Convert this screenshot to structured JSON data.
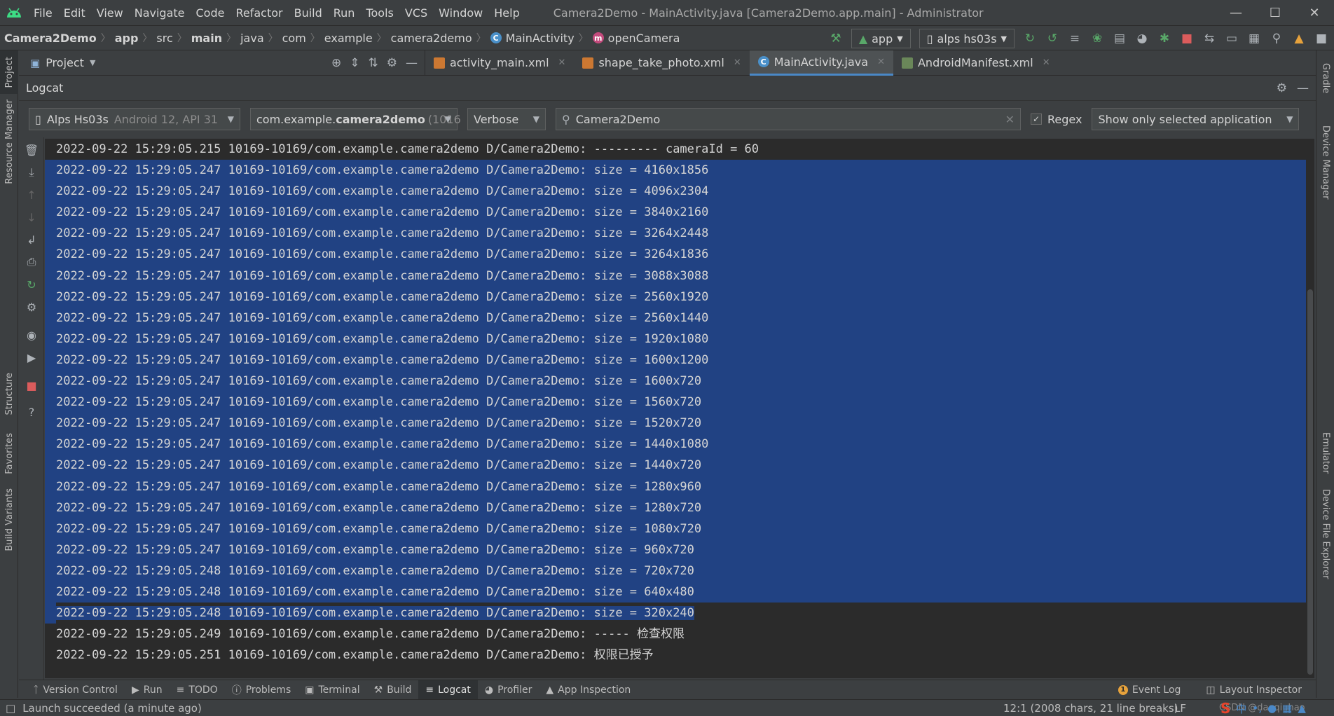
{
  "menubar": {
    "items": [
      "File",
      "Edit",
      "View",
      "Navigate",
      "Code",
      "Refactor",
      "Build",
      "Run",
      "Tools",
      "VCS",
      "Window",
      "Help"
    ],
    "title": "Camera2Demo - MainActivity.java [Camera2Demo.app.main] - Administrator"
  },
  "nav": {
    "crumbs": [
      "Camera2Demo",
      "app",
      "src",
      "main",
      "java",
      "com",
      "example",
      "camera2demo"
    ],
    "class_name": "MainActivity",
    "method_name": "openCamera",
    "run_config": "app",
    "device": "alps hs03s"
  },
  "project_panel": {
    "label": "Project"
  },
  "editor_tabs": [
    {
      "label": "activity_main.xml",
      "icon": "xml-file-icon"
    },
    {
      "label": "shape_take_photo.xml",
      "icon": "xml-file-icon"
    },
    {
      "label": "MainActivity.java",
      "icon": "java-class-icon",
      "active": true
    },
    {
      "label": "AndroidManifest.xml",
      "icon": "manifest-file-icon"
    }
  ],
  "logcat": {
    "title": "Logcat",
    "device_prefix": "Alps Hs03s",
    "device_suffix": "Android 12, API 31",
    "process_prefix": "com.example.",
    "process_bold": "camera2demo",
    "process_pid": "(1016",
    "level": "Verbose",
    "search": "Camera2Demo",
    "regex_label": "Regex",
    "regex_checked": true,
    "filter": "Show only selected application",
    "lines": [
      {
        "text": "2022-09-22 15:29:05.215 10169-10169/com.example.camera2demo D/Camera2Demo: --------- cameraId = 60",
        "selected": false
      },
      {
        "text": "2022-09-22 15:29:05.247 10169-10169/com.example.camera2demo D/Camera2Demo: size = 4160x1856",
        "selected": true
      },
      {
        "text": "2022-09-22 15:29:05.247 10169-10169/com.example.camera2demo D/Camera2Demo: size = 4096x2304",
        "selected": true
      },
      {
        "text": "2022-09-22 15:29:05.247 10169-10169/com.example.camera2demo D/Camera2Demo: size = 3840x2160",
        "selected": true
      },
      {
        "text": "2022-09-22 15:29:05.247 10169-10169/com.example.camera2demo D/Camera2Demo: size = 3264x2448",
        "selected": true
      },
      {
        "text": "2022-09-22 15:29:05.247 10169-10169/com.example.camera2demo D/Camera2Demo: size = 3264x1836",
        "selected": true
      },
      {
        "text": "2022-09-22 15:29:05.247 10169-10169/com.example.camera2demo D/Camera2Demo: size = 3088x3088",
        "selected": true
      },
      {
        "text": "2022-09-22 15:29:05.247 10169-10169/com.example.camera2demo D/Camera2Demo: size = 2560x1920",
        "selected": true
      },
      {
        "text": "2022-09-22 15:29:05.247 10169-10169/com.example.camera2demo D/Camera2Demo: size = 2560x1440",
        "selected": true
      },
      {
        "text": "2022-09-22 15:29:05.247 10169-10169/com.example.camera2demo D/Camera2Demo: size = 1920x1080",
        "selected": true
      },
      {
        "text": "2022-09-22 15:29:05.247 10169-10169/com.example.camera2demo D/Camera2Demo: size = 1600x1200",
        "selected": true
      },
      {
        "text": "2022-09-22 15:29:05.247 10169-10169/com.example.camera2demo D/Camera2Demo: size = 1600x720",
        "selected": true
      },
      {
        "text": "2022-09-22 15:29:05.247 10169-10169/com.example.camera2demo D/Camera2Demo: size = 1560x720",
        "selected": true
      },
      {
        "text": "2022-09-22 15:29:05.247 10169-10169/com.example.camera2demo D/Camera2Demo: size = 1520x720",
        "selected": true
      },
      {
        "text": "2022-09-22 15:29:05.247 10169-10169/com.example.camera2demo D/Camera2Demo: size = 1440x1080",
        "selected": true
      },
      {
        "text": "2022-09-22 15:29:05.247 10169-10169/com.example.camera2demo D/Camera2Demo: size = 1440x720",
        "selected": true
      },
      {
        "text": "2022-09-22 15:29:05.247 10169-10169/com.example.camera2demo D/Camera2Demo: size = 1280x960",
        "selected": true
      },
      {
        "text": "2022-09-22 15:29:05.247 10169-10169/com.example.camera2demo D/Camera2Demo: size = 1280x720",
        "selected": true
      },
      {
        "text": "2022-09-22 15:29:05.247 10169-10169/com.example.camera2demo D/Camera2Demo: size = 1080x720",
        "selected": true
      },
      {
        "text": "2022-09-22 15:29:05.247 10169-10169/com.example.camera2demo D/Camera2Demo: size = 960x720",
        "selected": true
      },
      {
        "text": "2022-09-22 15:29:05.248 10169-10169/com.example.camera2demo D/Camera2Demo: size = 720x720",
        "selected": true
      },
      {
        "text": "2022-09-22 15:29:05.248 10169-10169/com.example.camera2demo D/Camera2Demo: size = 640x480",
        "selected": true
      },
      {
        "text": "2022-09-22 15:29:05.248 10169-10169/com.example.camera2demo D/Camera2Demo: size = 320x240",
        "selected": true
      },
      {
        "text": "2022-09-22 15:29:05.249 10169-10169/com.example.camera2demo D/Camera2Demo: ----- 检查权限",
        "selected": false
      },
      {
        "text": "2022-09-22 15:29:05.251 10169-10169/com.example.camera2demo D/Camera2Demo: 权限已授予",
        "selected": false
      }
    ]
  },
  "left_strip": [
    "Project",
    "Resource Manager",
    "Structure",
    "Favorites",
    "Build Variants"
  ],
  "right_strip": [
    "Gradle",
    "Device Manager",
    "Emulator",
    "Device File Explorer"
  ],
  "tool_windows": {
    "left": [
      "Version Control",
      "Run",
      "TODO",
      "Problems",
      "Terminal",
      "Build",
      "Logcat",
      "Profiler",
      "App Inspection"
    ],
    "active": "Logcat",
    "right": [
      "Event Log",
      "Layout Inspector"
    ],
    "event_count": "1"
  },
  "status": {
    "message": "Launch succeeded (a minute ago)",
    "position": "12:1 (2008 chars, 21 line breaks)",
    "line_sep": "LF",
    "watermark": "CSDN @daoqiuhao",
    "ime": "中"
  },
  "colors": {
    "selection": "#214283",
    "background": "#2b2b2b",
    "accent": "#4a88c7",
    "android_green": "#3ddc84"
  }
}
